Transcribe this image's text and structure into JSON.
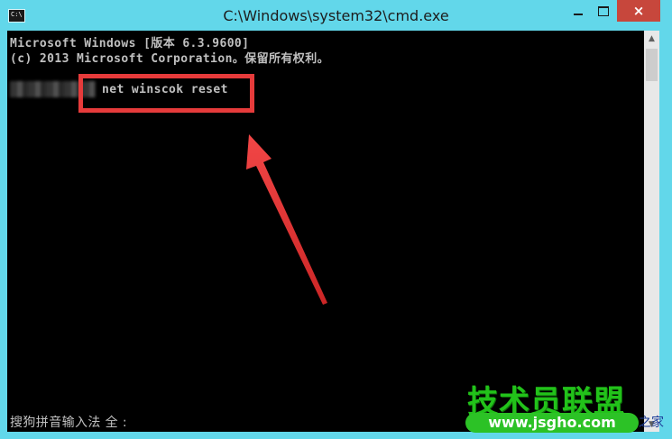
{
  "window": {
    "title": "C:\\Windows\\system32\\cmd.exe",
    "icon_label": "C:\\",
    "controls": {
      "minimize": "minimize",
      "maximize": "maximize",
      "close": "×"
    }
  },
  "console": {
    "line1": "Microsoft Windows [版本 6.3.9600]",
    "line2": "(c) 2013 Microsoft Corporation。保留所有权利。",
    "command": "net winscok reset",
    "ime_status": "搜狗拼音输入法 全 :"
  },
  "watermark": {
    "title": "技术员联盟",
    "url": "www.jsgho.com",
    "suffix": "之家"
  },
  "colors": {
    "frame": "#62d7ea",
    "console_bg": "#000000",
    "console_text": "#c0c0c0",
    "highlight": "#e63b3b",
    "close_button": "#c7473c"
  },
  "icons": [
    "cmd-app-icon",
    "minimize-icon",
    "maximize-icon",
    "close-icon",
    "scroll-up-icon",
    "scroll-down-icon",
    "red-arrow"
  ]
}
